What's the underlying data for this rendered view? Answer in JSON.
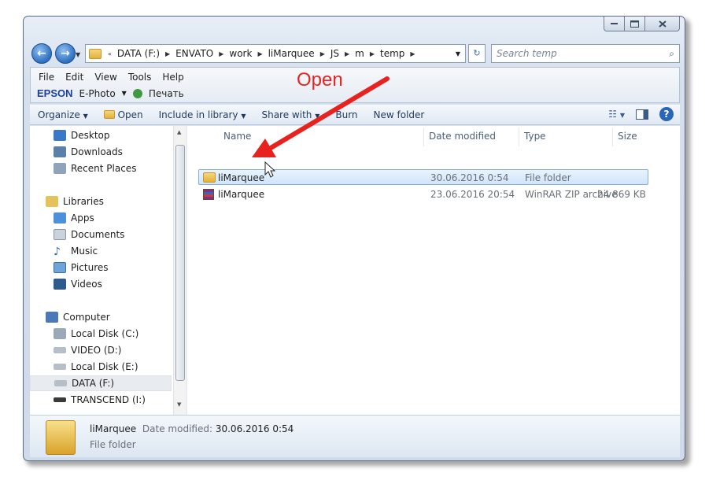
{
  "address": {
    "chevron": "«",
    "crumbs": [
      "DATA (F:)",
      "ENVATO",
      "work",
      "liMarquee",
      "JS",
      "m",
      "temp"
    ],
    "search_placeholder": "Search temp"
  },
  "menu": {
    "items": [
      "File",
      "Edit",
      "View",
      "Tools",
      "Help"
    ],
    "epson": "EPSON",
    "ephoto": "E-Photo",
    "print": "Печать"
  },
  "toolbar": {
    "organize": "Organize",
    "open": "Open",
    "include_in_library": "Include in library",
    "share_with": "Share with",
    "burn": "Burn",
    "new_folder": "New folder"
  },
  "nav": {
    "favorites": [
      "Desktop",
      "Downloads",
      "Recent Places"
    ],
    "libraries_label": "Libraries",
    "libraries": [
      "Apps",
      "Documents",
      "Music",
      "Pictures",
      "Videos"
    ],
    "computer_label": "Computer",
    "drives": [
      "Local Disk (C:)",
      "VIDEO (D:)",
      "Local Disk (E:)",
      "DATA (F:)",
      "TRANSCEND (I:)"
    ]
  },
  "columns": {
    "name": "Name",
    "date": "Date modified",
    "type": "Type",
    "size": "Size"
  },
  "files": [
    {
      "name": "liMarquee",
      "date": "30.06.2016 0:54",
      "type": "File folder",
      "size": ""
    },
    {
      "name": "liMarquee",
      "date": "23.06.2016 20:54",
      "type": "WinRAR ZIP archive",
      "size": "24 869 KB"
    }
  ],
  "details": {
    "name": "liMarquee",
    "date_label": "Date modified:",
    "date": "30.06.2016 0:54",
    "type": "File folder"
  },
  "annotation": {
    "text": "Open",
    "color": "#e8231f"
  },
  "icons": [
    "back-icon",
    "forward-icon",
    "folder-icon",
    "refresh-icon",
    "search-icon",
    "help-icon",
    "view-icon",
    "preview-pane-icon",
    "zip-archive-icon",
    "arrow-annotation",
    "cursor-icon"
  ]
}
